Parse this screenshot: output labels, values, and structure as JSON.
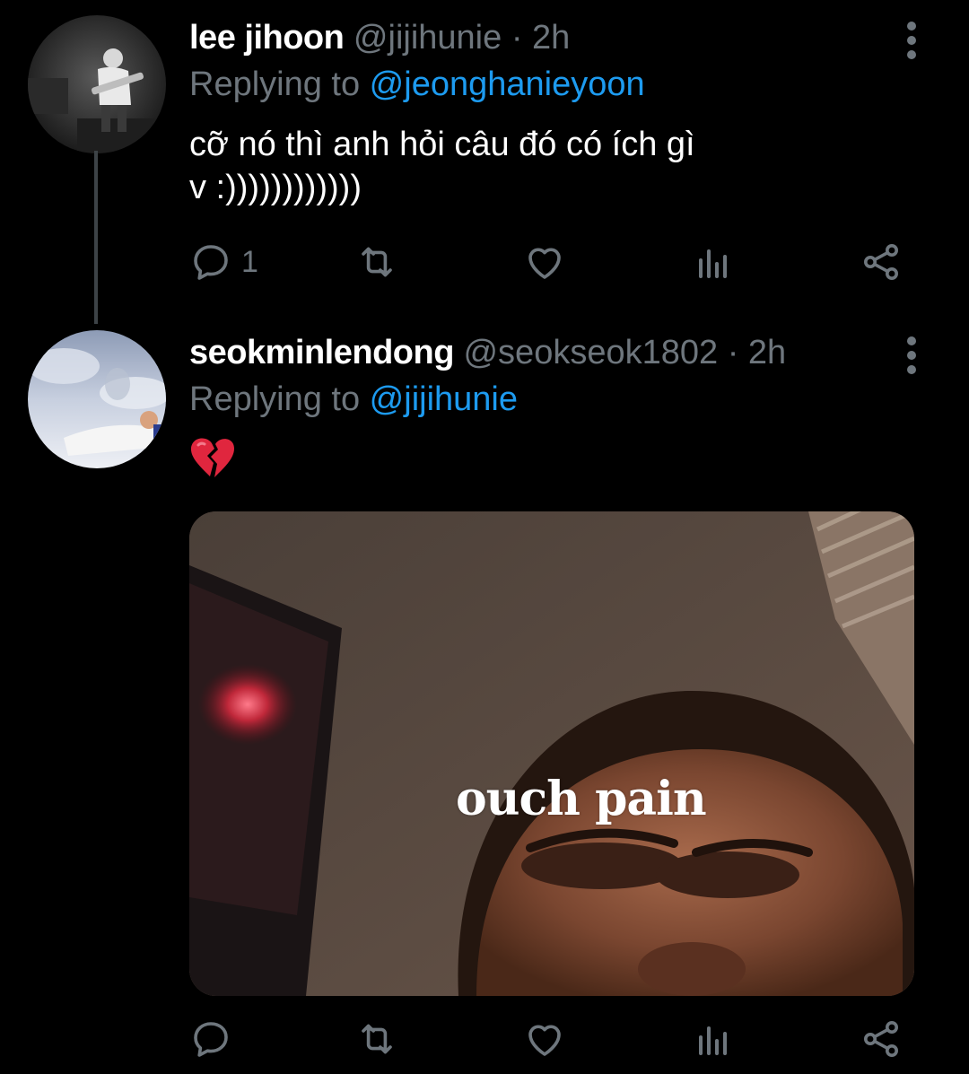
{
  "tweets": [
    {
      "name": "lee jihoon",
      "handle": "@jijihunie",
      "separator": "·",
      "time": "2h",
      "replying_prefix": "Replying to ",
      "replying_to": "@jeonghanieyoon",
      "text_line1": "cỡ nó thì anh hỏi câu đó có ích gì",
      "text_line2": "v :))))))))))))",
      "reply_count": "1"
    },
    {
      "name": "seokminlendong",
      "handle": "@seokseok1802",
      "separator": "·",
      "time": "2h",
      "replying_prefix": "Replying to ",
      "replying_to": "@jijihunie",
      "emoji": "broken-heart",
      "media_caption": "ouch pain",
      "reply_count": ""
    }
  ],
  "colors": {
    "background": "#000000",
    "text_primary": "#ffffff",
    "text_secondary": "#6e767d",
    "accent": "#1d9bf0"
  },
  "icons": [
    "reply-icon",
    "retweet-icon",
    "like-icon",
    "analytics-icon",
    "share-icon",
    "more-options-icon",
    "broken-heart-icon"
  ]
}
